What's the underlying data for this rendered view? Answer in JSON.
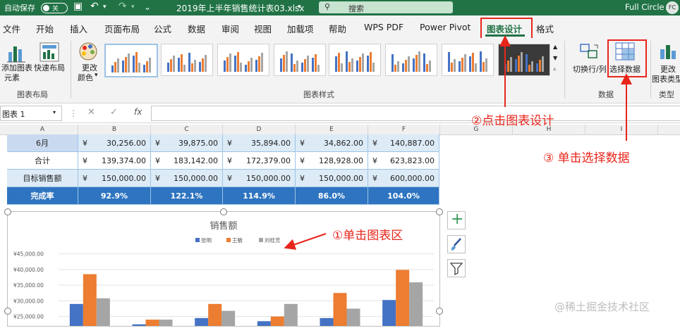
{
  "titlebar": {
    "autosave_label": "自动保存",
    "autosave_state": "关",
    "filename": "2019年上半年销售统计表03.xlsx",
    "search_placeholder": "搜索",
    "user_name": "Full Circle",
    "user_initials": "FC"
  },
  "menu": {
    "items": [
      "文件",
      "开始",
      "插入",
      "页面布局",
      "公式",
      "数据",
      "审阅",
      "视图",
      "加载项",
      "帮助",
      "WPS PDF",
      "Power Pivot",
      "图表设计",
      "格式"
    ],
    "active_index": 12
  },
  "ribbon": {
    "add_element_label": "添加图表",
    "add_element_label2": "元素",
    "quick_layout_label": "快速布局",
    "change_colors_label": "更改",
    "change_colors_label2": "颜色",
    "layout_group_label": "图表布局",
    "styles_group_label": "图表样式",
    "switch_rowcol_label": "切换行/列",
    "select_data_label": "选择数据",
    "data_group_label": "数据",
    "change_type_label": "更改",
    "change_type_label2": "图表类型",
    "type_group_label": "类型"
  },
  "formula_bar": {
    "name_box": "图表 1",
    "fx_label": "fx",
    "formula": ""
  },
  "columns": [
    "A",
    "B",
    "C",
    "D",
    "E",
    "F",
    "G",
    "H",
    "I"
  ],
  "table": {
    "currency_symbol": "¥",
    "rows": [
      {
        "label": "6月",
        "values": [
          "30,256.00",
          "39,875.00",
          "35,894.00",
          "34,862.00",
          "140,887.00"
        ]
      },
      {
        "label": "合计",
        "values": [
          "139,374.00",
          "183,142.00",
          "172,379.00",
          "128,928.00",
          "623,823.00"
        ]
      },
      {
        "label": "目标销售额",
        "values": [
          "150,000.00",
          "150,000.00",
          "150,000.00",
          "150,000.00",
          "600,000.00"
        ]
      },
      {
        "label": "完成率",
        "values": [
          "92.9%",
          "122.1%",
          "114.9%",
          "86.0%",
          "104.0%"
        ]
      }
    ]
  },
  "chart_data": {
    "type": "bar",
    "title": "销售额",
    "series": [
      {
        "name": "张明",
        "values": [
          29000,
          22500,
          24500,
          23500,
          24500,
          30256
        ]
      },
      {
        "name": "王敏",
        "values": [
          38500,
          24000,
          29000,
          25000,
          32500,
          39875
        ]
      },
      {
        "name": "刘桂芳",
        "values": [
          30800,
          24000,
          26800,
          29000,
          27500,
          35894
        ]
      }
    ],
    "colors": [
      "#4472c4",
      "#ed7d31",
      "#a5a5a5"
    ],
    "yticks": [
      "¥45,000.00",
      "¥40,000.00",
      "¥35,000.00",
      "¥30,000.00",
      "¥25,000.00"
    ],
    "ylim": [
      22000,
      48500
    ]
  },
  "annotations": {
    "step1": "①单击图表区",
    "step2": "②点击图表设计",
    "step3": "③ 单击选择数据"
  },
  "watermark": "@稀土掘金技术社区"
}
